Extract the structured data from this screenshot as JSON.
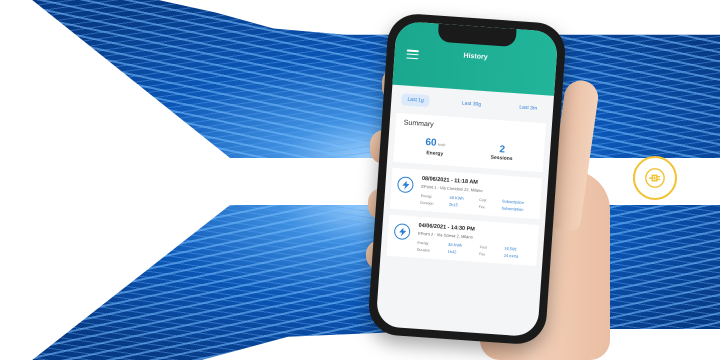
{
  "app": {
    "title": "History",
    "tabs": [
      {
        "label": "Last 1g",
        "active": true
      },
      {
        "label": "Last 30g",
        "active": false
      },
      {
        "label": "Last 3m",
        "active": false
      }
    ]
  },
  "summary": {
    "title": "Summary",
    "energy_value": "60",
    "energy_unit": "kwh",
    "energy_label": "Energy",
    "sessions_value": "2",
    "sessions_label": "Sessions"
  },
  "sessions": [
    {
      "datetime": "08/06/2021 - 11:18 AM",
      "place": "EPoint 1 - Via Corridoni 22, Milano",
      "energy_label": "Energy",
      "energy_value": "48 KWh",
      "duration_label": "Duration",
      "duration_value": "2h15",
      "cost_label": "Cost",
      "cost_value": "Subscription",
      "fee_label": "Fee",
      "fee_value": "Subscription"
    },
    {
      "datetime": "04/06/2021 - 14:30 PM",
      "place": "EPoint 2 - Via Sciesa 2, Milano",
      "energy_label": "Energy",
      "energy_value": "38 KWh",
      "duration_label": "Duration",
      "duration_value": "1h42",
      "cost_label": "Cost",
      "cost_value": "16,50€",
      "fee_label": "Fee",
      "fee_value": "24 extra"
    }
  ],
  "colors": {
    "accent_green": "#1aa88f",
    "link_blue": "#2d7fd3",
    "badge_yellow": "#f1c232",
    "bg_blue": "#0b56b5"
  },
  "icons": {
    "menu": "hamburger-icon",
    "session": "lightning-icon",
    "badge": "ev-plug-icon"
  }
}
